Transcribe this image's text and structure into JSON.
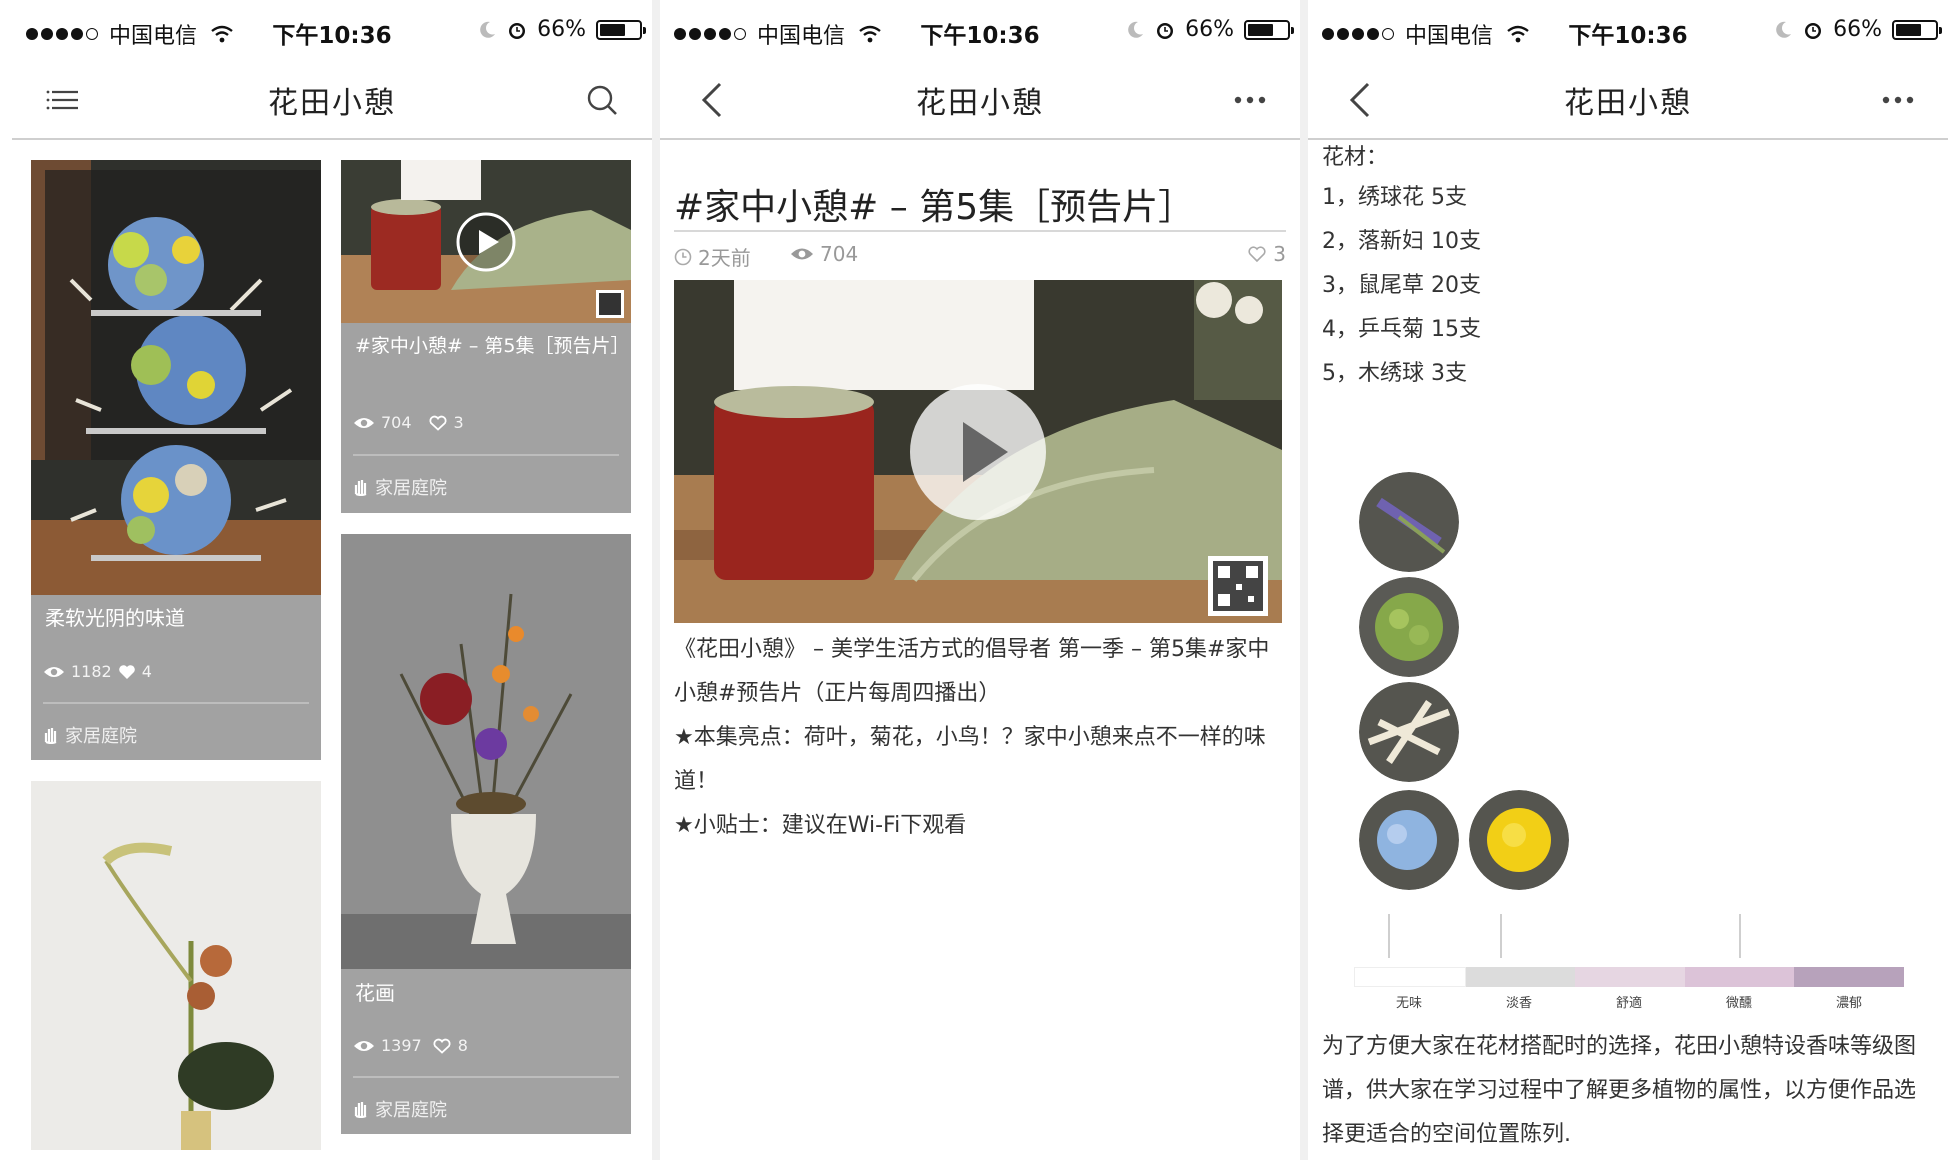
{
  "status_bar": {
    "carrier": "中国电信",
    "time": "下午10:36",
    "battery": "66%"
  },
  "screen1": {
    "title": "花田小憩",
    "menu_icon": "menu-icon",
    "search_icon": "search-icon",
    "cards": [
      {
        "title": "柔软光阴的味道",
        "views": "1182",
        "likes": "4",
        "category": "家居庭院"
      },
      {
        "title": "#家中小憩# – 第5集［预告片］",
        "views": "704",
        "likes": "3",
        "category": "家居庭院"
      },
      {
        "title": "花画",
        "views": "1397",
        "likes": "8",
        "category": "家居庭院"
      }
    ]
  },
  "screen2": {
    "title": "花田小憩",
    "back_icon": "back-icon",
    "more_icon": "more-icon",
    "article_title": "#家中小憩# – 第5集［预告片］",
    "time_ago": "2天前",
    "views": "704",
    "likes": "3",
    "paragraphs": [
      "《花田小憩》 – 美学生活方式的倡导者 第一季 – 第5集#家中小憩#预告片（正片每周四播出）",
      "★本集亮点：荷叶，菊花，小鸟！？家中小憩来点不一样的味道！",
      "★小贴士：建议在Wi-Fi下观看"
    ]
  },
  "screen3": {
    "title": "花田小憩",
    "materials_header": "花材：",
    "materials": [
      "1，绣球花 5支",
      "2，落新妇 10支",
      "3，鼠尾草 20支",
      "4，乒乓菊 15支",
      "5，木绣球 3支"
    ],
    "scale_labels": [
      "无味",
      "淡香",
      "舒適",
      "微醺",
      "濃郁"
    ],
    "scale_colors": [
      "#ffffff",
      "#dcdcdc",
      "#e6d6e2",
      "#dcc3d8",
      "#b7a2bb"
    ],
    "description": "为了方便大家在花材搭配时的选择，花田小憩特设香味等级图谱，供大家在学习过程中了解更多植物的属性，以方便作品选择更适合的空间位置陈列."
  },
  "colors": {
    "card_bg": "#a2a2a2",
    "divider": "#cfcfcf",
    "meta_gray": "#999999"
  }
}
